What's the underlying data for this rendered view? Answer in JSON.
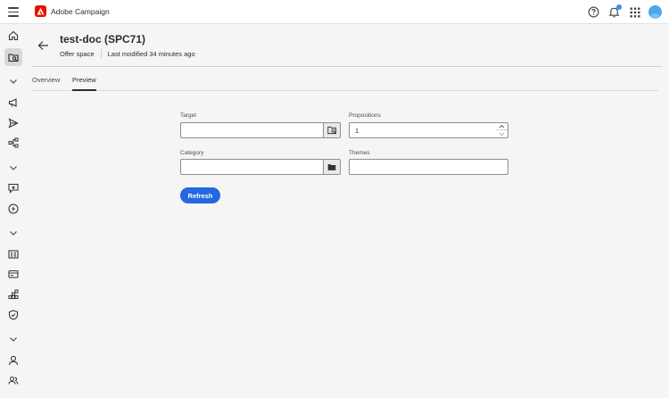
{
  "app": {
    "name": "Adobe Campaign"
  },
  "header": {
    "title": "test-doc (SPC71)",
    "type_label": "Offer space",
    "modified_label": "Last modified 34 minutes ago"
  },
  "tabs": [
    {
      "label": "Overview",
      "active": false
    },
    {
      "label": "Preview",
      "active": true
    }
  ],
  "form": {
    "target": {
      "label": "Target",
      "value": ""
    },
    "propositions": {
      "label": "Propositions",
      "value": "1"
    },
    "category": {
      "label": "Category",
      "value": ""
    },
    "themes": {
      "label": "Themes",
      "value": ""
    },
    "refresh_label": "Refresh"
  },
  "colors": {
    "brand": "#eb1000",
    "accent": "#2468e0",
    "notification": "#3b8cf4"
  },
  "sidebar_icons": [
    "home-icon",
    "explorer-icon",
    "chevron-down-icon",
    "campaign-icon",
    "send-icon",
    "workflow-icon",
    "chevron-down-icon",
    "offer-icon",
    "lightning-icon",
    "chevron-down-icon",
    "audience-icon",
    "content-icon",
    "fragments-icon",
    "shield-icon",
    "chevron-down-icon",
    "user-icon",
    "group-icon"
  ]
}
